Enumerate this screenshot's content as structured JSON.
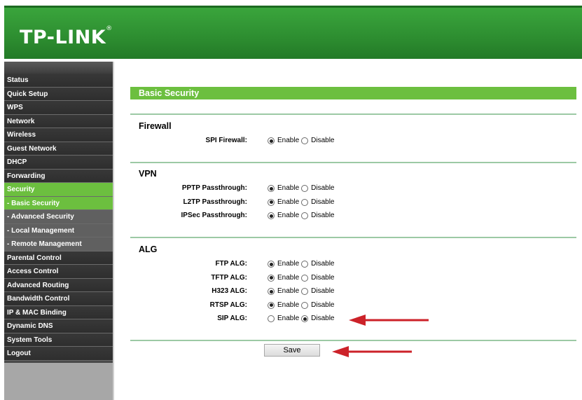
{
  "header": {
    "logo": "TP-LINK",
    "logo_mark": "®"
  },
  "sidebar": {
    "items": [
      {
        "label": "Status",
        "type": "main",
        "active": false
      },
      {
        "label": "Quick Setup",
        "type": "main",
        "active": false
      },
      {
        "label": "WPS",
        "type": "main",
        "active": false
      },
      {
        "label": "Network",
        "type": "main",
        "active": false
      },
      {
        "label": "Wireless",
        "type": "main",
        "active": false
      },
      {
        "label": "Guest Network",
        "type": "main",
        "active": false
      },
      {
        "label": "DHCP",
        "type": "main",
        "active": false
      },
      {
        "label": "Forwarding",
        "type": "main",
        "active": false
      },
      {
        "label": "Security",
        "type": "main",
        "active": true
      },
      {
        "label": "- Basic Security",
        "type": "sub",
        "active": true
      },
      {
        "label": "- Advanced Security",
        "type": "sub",
        "active": false
      },
      {
        "label": "- Local Management",
        "type": "sub",
        "active": false
      },
      {
        "label": "- Remote Management",
        "type": "sub",
        "active": false
      },
      {
        "label": "Parental Control",
        "type": "main",
        "active": false
      },
      {
        "label": "Access Control",
        "type": "main",
        "active": false
      },
      {
        "label": "Advanced Routing",
        "type": "main",
        "active": false
      },
      {
        "label": "Bandwidth Control",
        "type": "main",
        "active": false
      },
      {
        "label": "IP & MAC Binding",
        "type": "main",
        "active": false
      },
      {
        "label": "Dynamic DNS",
        "type": "main",
        "active": false
      },
      {
        "label": "System Tools",
        "type": "main",
        "active": false
      },
      {
        "label": "Logout",
        "type": "main",
        "active": false
      }
    ]
  },
  "main": {
    "title": "Basic Security",
    "enable_label": "Enable",
    "disable_label": "Disable",
    "sections": {
      "firewall": {
        "title": "Firewall",
        "rows": [
          {
            "label": "SPI Firewall:",
            "value": "Enable"
          }
        ]
      },
      "vpn": {
        "title": "VPN",
        "rows": [
          {
            "label": "PPTP Passthrough:",
            "value": "Enable"
          },
          {
            "label": "L2TP Passthrough:",
            "value": "Enable"
          },
          {
            "label": "IPSec Passthrough:",
            "value": "Enable"
          }
        ]
      },
      "alg": {
        "title": "ALG",
        "rows": [
          {
            "label": "FTP ALG:",
            "value": "Enable"
          },
          {
            "label": "TFTP ALG:",
            "value": "Enable"
          },
          {
            "label": "H323 ALG:",
            "value": "Enable"
          },
          {
            "label": "RTSP ALG:",
            "value": "Enable"
          },
          {
            "label": "SIP ALG:",
            "value": "Disable"
          }
        ]
      }
    },
    "save_label": "Save"
  },
  "colors": {
    "header_green": "#2e8f31",
    "accent_green": "#6cbf3f",
    "sidebar_dark": "#333333",
    "arrow_red": "#cc2229"
  },
  "annotations": [
    {
      "icon": "red-arrow-icon",
      "target": "SIP ALG"
    },
    {
      "icon": "red-arrow-icon",
      "target": "Save"
    }
  ]
}
